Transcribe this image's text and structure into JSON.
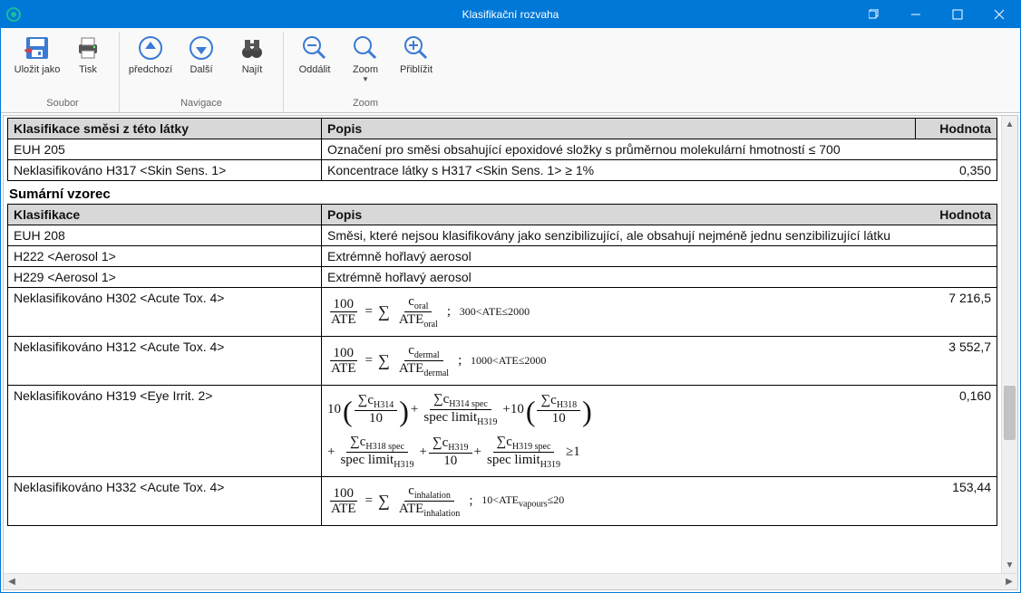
{
  "window": {
    "title": "Klasifikační rozvaha"
  },
  "ribbon": {
    "groups": [
      {
        "label": "Soubor",
        "buttons": [
          {
            "name": "save-as-button",
            "label": "Uložit jako",
            "icon": "save"
          },
          {
            "name": "print-button",
            "label": "Tisk",
            "icon": "print"
          }
        ]
      },
      {
        "label": "Navigace",
        "buttons": [
          {
            "name": "prev-button",
            "label": "předchozí",
            "icon": "up"
          },
          {
            "name": "next-button",
            "label": "Další",
            "icon": "down"
          },
          {
            "name": "find-button",
            "label": "Najít",
            "icon": "binoculars"
          }
        ]
      },
      {
        "label": "Zoom",
        "buttons": [
          {
            "name": "zoom-out-button",
            "label": "Oddálit",
            "icon": "zoom-out"
          },
          {
            "name": "zoom-button",
            "label": "Zoom",
            "icon": "zoom",
            "dropdown": true
          },
          {
            "name": "zoom-in-button",
            "label": "Přiblížit",
            "icon": "zoom-in"
          }
        ]
      }
    ]
  },
  "doc": {
    "table1": {
      "headers": {
        "klas": "Klasifikace směsi z této látky",
        "popis": "Popis",
        "hodnota": "Hodnota"
      },
      "rows": [
        {
          "klas": "EUH 205",
          "popis": "Označení pro směsi obsahující epoxidové složky s průměrnou molekulární hmotností ≤ 700",
          "val": ""
        },
        {
          "klas": "Neklasifikováno H317 <Skin Sens. 1>",
          "popis": "Koncentrace látky s H317 <Skin Sens. 1> ≥ 1%",
          "val": "0,350"
        }
      ]
    },
    "section2_title": "Sumární vzorec",
    "table2": {
      "headers": {
        "klas": "Klasifikace",
        "popis": "Popis",
        "hodnota": "Hodnota"
      },
      "rows_simple": [
        {
          "klas": "EUH 208",
          "popis": "Směsi, které nejsou klasifikovány jako senzibilizující, ale obsahují nejméně jednu senzibilizující látku",
          "val": ""
        },
        {
          "klas": "H222 <Aerosol 1>",
          "popis": "Extrémně hořlavý aerosol",
          "val": ""
        },
        {
          "klas": "H229 <Aerosol 1>",
          "popis": "Extrémně hořlavý aerosol",
          "val": ""
        }
      ],
      "row_h302": {
        "klas": "Neklasifikováno H302 <Acute Tox. 4>",
        "val": "7 216,5",
        "range": "300<ATE≤2000",
        "c_sub": "oral",
        "ate_sub": "oral"
      },
      "row_h312": {
        "klas": "Neklasifikováno H312 <Acute Tox. 4>",
        "val": "3 552,7",
        "range": "1000<ATE≤2000",
        "c_sub": "dermal",
        "ate_sub": "dermal"
      },
      "row_h319": {
        "klas": "Neklasifikováno H319 <Eye Irrit. 2>",
        "val": "0,160"
      },
      "row_h332": {
        "klas": "Neklasifikováno H332 <Acute Tox. 4>",
        "val": "153,44",
        "range_pre": "10<ATE",
        "range_sub": "vapours",
        "range_post": "≤20",
        "c_sub": "inhalation",
        "ate_sub": "inhalation"
      }
    }
  }
}
